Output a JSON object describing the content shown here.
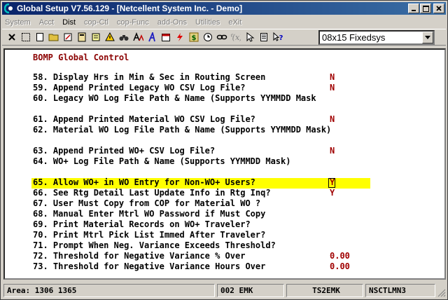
{
  "window": {
    "title": "Global Setup V7.56.129 - [Netcellent System Inc. - Demo]",
    "buttons": {
      "minimize": "_",
      "maximize": "□",
      "close": "×"
    }
  },
  "menu": [
    "System",
    "Acct",
    "Dist",
    "cop-Ctl",
    "cop-Func",
    "add-Ons",
    "Utilities",
    "eXit"
  ],
  "toolbar": {
    "icons": [
      "close-x-icon",
      "select-icon",
      "new-document-icon",
      "open-folder-icon",
      "edit-icon",
      "calculator-icon",
      "note-icon",
      "warning-icon",
      "binoculars-icon",
      "font-icon",
      "font-style-icon",
      "calendar-icon",
      "lightning-icon",
      "dollar-icon",
      "clock-icon",
      "link-icon",
      "run-icon",
      "pointer-icon",
      "document-icon",
      "help-icon"
    ],
    "font_select": "08x15 Fixedsys"
  },
  "screen": {
    "title": "BOMP Global Control",
    "lines": [
      {
        "num": "58.",
        "label": "Display Hrs in Min & Sec in Routing Screen",
        "value": "N"
      },
      {
        "num": "59.",
        "label": "Append Printed Legacy WO CSV Log File?",
        "value": "N"
      },
      {
        "num": "60.",
        "label": "Legacy WO Log File Path & Name (Supports YYMMDD Mask",
        "value": ""
      },
      {
        "num": "61.",
        "label": "Append Printed Material WO CSV Log File?",
        "value": "N"
      },
      {
        "num": "62.",
        "label": "Material WO Log File Path & Name (Supports YYMMDD Mask)",
        "value": ""
      },
      {
        "num": "63.",
        "label": "Append Printed WO+ CSV Log File?",
        "value": "N"
      },
      {
        "num": "64.",
        "label": "WO+ Log File Path & Name (Supports YYMMDD Mask)",
        "value": ""
      },
      {
        "num": "65.",
        "label": "Allow WO+ in WO Entry for Non-WO+ Users?",
        "value": "Y"
      },
      {
        "num": "66.",
        "label": "See Rtg Detail Last Update Info in Rtg Inq?",
        "value": "Y"
      },
      {
        "num": "67.",
        "label": "User Must Copy from COP for Material WO ?",
        "value": ""
      },
      {
        "num": "68.",
        "label": "Manual Enter Mtrl WO Password if Must Copy",
        "value": ""
      },
      {
        "num": "69.",
        "label": "Print Material Records on WO+ Traveler?",
        "value": ""
      },
      {
        "num": "70.",
        "label": "Print Mtrl Pick List Immed After Traveler?",
        "value": ""
      },
      {
        "num": "71.",
        "label": "Prompt When Neg. Variance Exceeds Threshold?",
        "value": ""
      },
      {
        "num": "72.",
        "label": "Threshold for Negative Variance % Over",
        "value": "0.00"
      },
      {
        "num": "73.",
        "label": "Threshold for Negative Variance Hours Over",
        "value": "0.00"
      }
    ]
  },
  "status": {
    "area": "Area: 1306 1365",
    "company": "002 EMK",
    "user": "TS2EMK",
    "station": "NSCTLMN3"
  }
}
